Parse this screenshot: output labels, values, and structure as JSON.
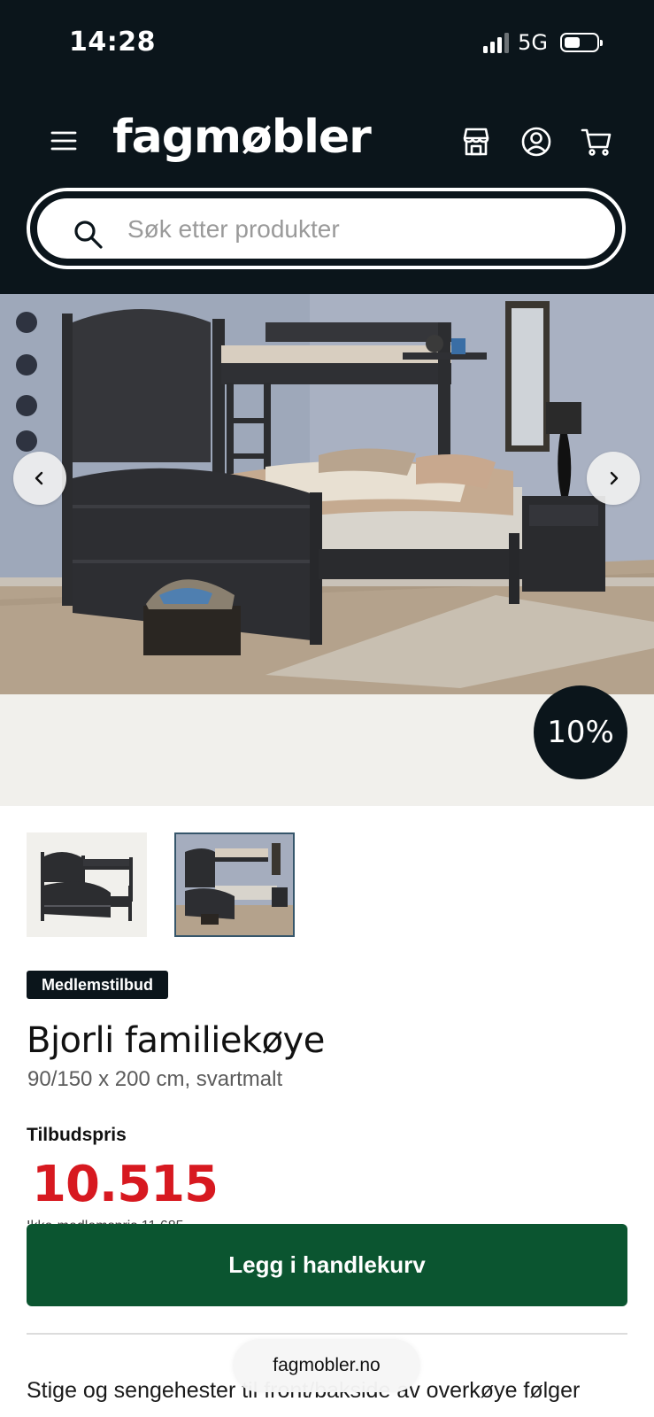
{
  "status_bar": {
    "time": "14:28",
    "network": "5G"
  },
  "header": {
    "logo": "fagmøbler",
    "icons": [
      "menu-icon",
      "store-icon",
      "account-icon",
      "cart-icon"
    ]
  },
  "search": {
    "placeholder": "Søk etter produkter"
  },
  "gallery": {
    "discount_badge": "10%",
    "thumbnail_count": 2,
    "selected_thumbnail": 2
  },
  "product": {
    "badge": "Medlemstilbud",
    "title": "Bjorli familiekøye",
    "subtitle": "90/150 x 200 cm, svartmalt",
    "price_label": "Tilbudspris",
    "price": "10.515",
    "member_price_text": "Ikke-medlemspris 11.685",
    "add_to_cart": "Legg i handlekurv",
    "description": "Stige og sengehester til front/bakside av overkøye følger"
  },
  "browser": {
    "url": "fagmobler.no"
  },
  "colors": {
    "header_bg": "#0b151b",
    "price_red": "#d71920",
    "cart_green": "#0b5530",
    "thumb_selected_border": "#36566b"
  }
}
